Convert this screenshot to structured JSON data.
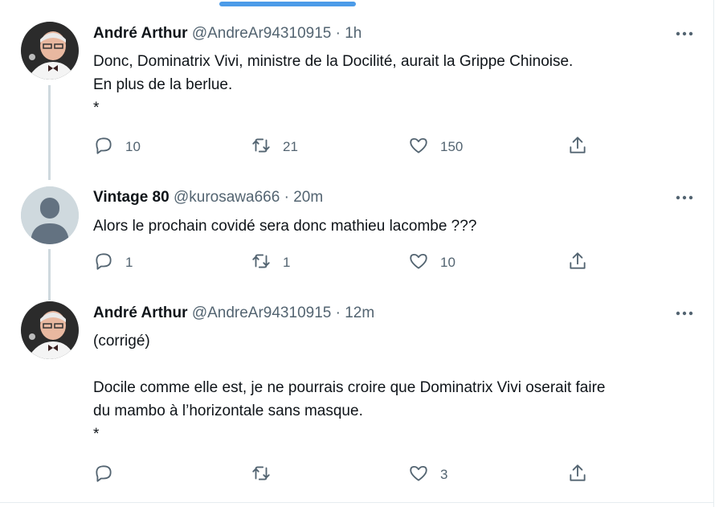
{
  "tweets": [
    {
      "name": "André Arthur",
      "handle": "@AndreAr94310915",
      "separator": "·",
      "time": "1h",
      "text": "Donc, Dominatrix Vivi, ministre de la Docilité, aurait la Grippe Chinoise.\nEn plus de la berlue.\n*",
      "replies": "10",
      "retweets": "21",
      "likes": "150"
    },
    {
      "name": "Vintage 80",
      "handle": "@kurosawa666",
      "separator": "·",
      "time": "20m",
      "text": "Alors le prochain covidé sera donc mathieu lacombe ???",
      "replies": "1",
      "retweets": "1",
      "likes": "10"
    },
    {
      "name": "André Arthur",
      "handle": "@AndreAr94310915",
      "separator": "·",
      "time": "12m",
      "text": "(corrigé)\n\nDocile comme elle est, je ne pourrais croire que Dominatrix Vivi oserait faire\ndu mambo à l’horizontale sans masque.\n*",
      "replies": "",
      "retweets": "",
      "likes": "3"
    }
  ],
  "icons": {
    "reply": "reply-icon",
    "retweet": "retweet-icon",
    "like": "heart-icon",
    "share": "share-icon",
    "more": "more-icon"
  },
  "colors": {
    "text": "#0f1419",
    "secondary": "#536471",
    "thread_line": "#cfd9de",
    "scroll_hint": "#4c9be8"
  }
}
